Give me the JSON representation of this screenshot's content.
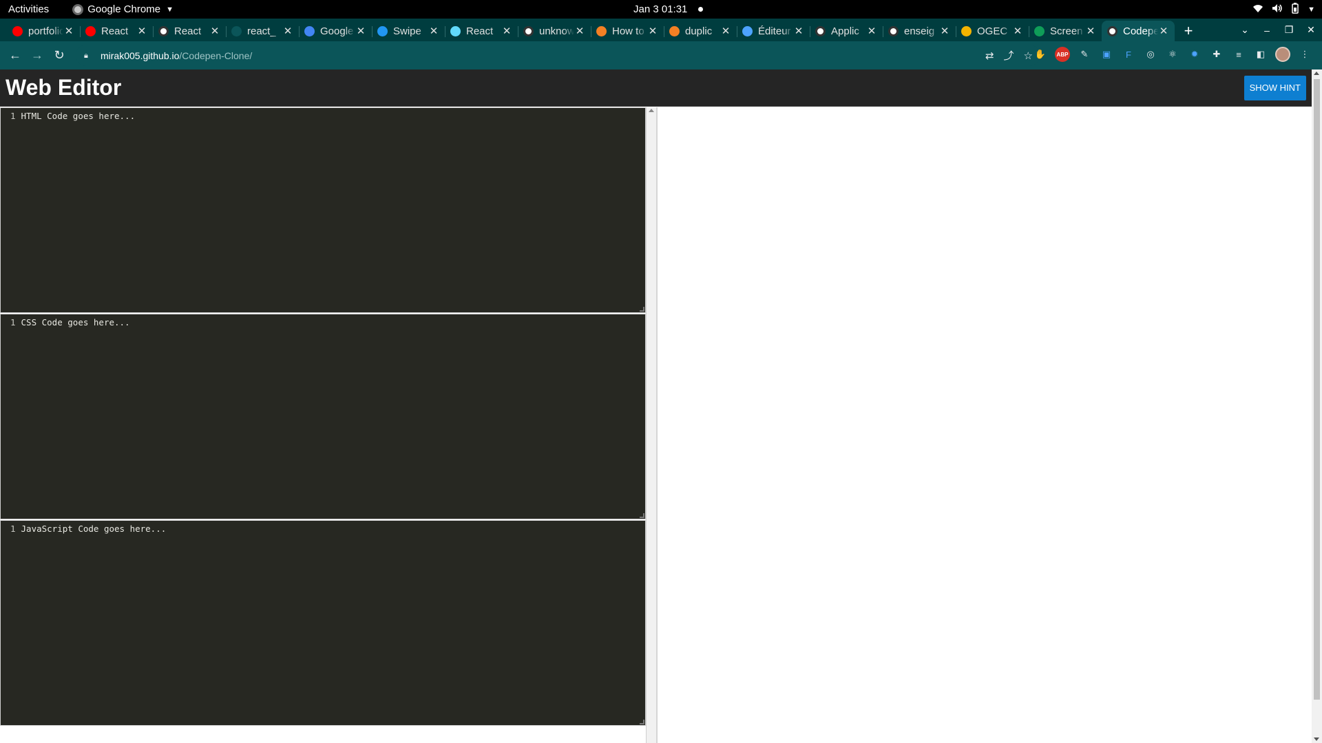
{
  "system_bar": {
    "activities": "Activities",
    "app_name": "Google Chrome",
    "clock": "Jan 3  01:31"
  },
  "tabs": [
    {
      "title": "portfolio",
      "icon": "youtube-icon",
      "color": "#ff0000"
    },
    {
      "title": "React",
      "icon": "youtube-icon",
      "color": "#ff0000"
    },
    {
      "title": "React",
      "icon": "github-icon",
      "color": "#ffffff"
    },
    {
      "title": "react_",
      "icon": "blank-page-icon",
      "color": "#0b5559"
    },
    {
      "title": "Google",
      "icon": "google-translate-icon",
      "color": "#4285f4"
    },
    {
      "title": "Swipe",
      "icon": "swiper-icon",
      "color": "#2196f3"
    },
    {
      "title": "React",
      "icon": "react-icon",
      "color": "#61dafb"
    },
    {
      "title": "unknown",
      "icon": "google-icon",
      "color": "#ffffff"
    },
    {
      "title": "How to",
      "icon": "stackoverflow-icon",
      "color": "#f48024"
    },
    {
      "title": "duplic",
      "icon": "stackoverflow-icon",
      "color": "#f48024"
    },
    {
      "title": "Éditeur",
      "icon": "cv-icon",
      "color": "#4da3ff"
    },
    {
      "title": "Applic",
      "icon": "github-icon",
      "color": "#ffffff"
    },
    {
      "title": "enseig",
      "icon": "google-icon",
      "color": "#ffffff"
    },
    {
      "title": "OGEC",
      "icon": "chart-icon",
      "color": "#f4b400"
    },
    {
      "title": "Screen",
      "icon": "google-drive-icon",
      "color": "#0f9d58"
    },
    {
      "title": "Codepen",
      "icon": "github-icon",
      "color": "#ffffff",
      "active": true
    }
  ],
  "address_bar": {
    "host": "mirak005.github.io",
    "path": "/Codepen-Clone/"
  },
  "page": {
    "title": "Web Editor",
    "hint_button": "SHOW HINT",
    "editors": [
      {
        "line_number": "1",
        "placeholder": "HTML Code goes here..."
      },
      {
        "line_number": "1",
        "placeholder": "CSS Code goes here..."
      },
      {
        "line_number": "1",
        "placeholder": "JavaScript Code goes here..."
      }
    ]
  }
}
